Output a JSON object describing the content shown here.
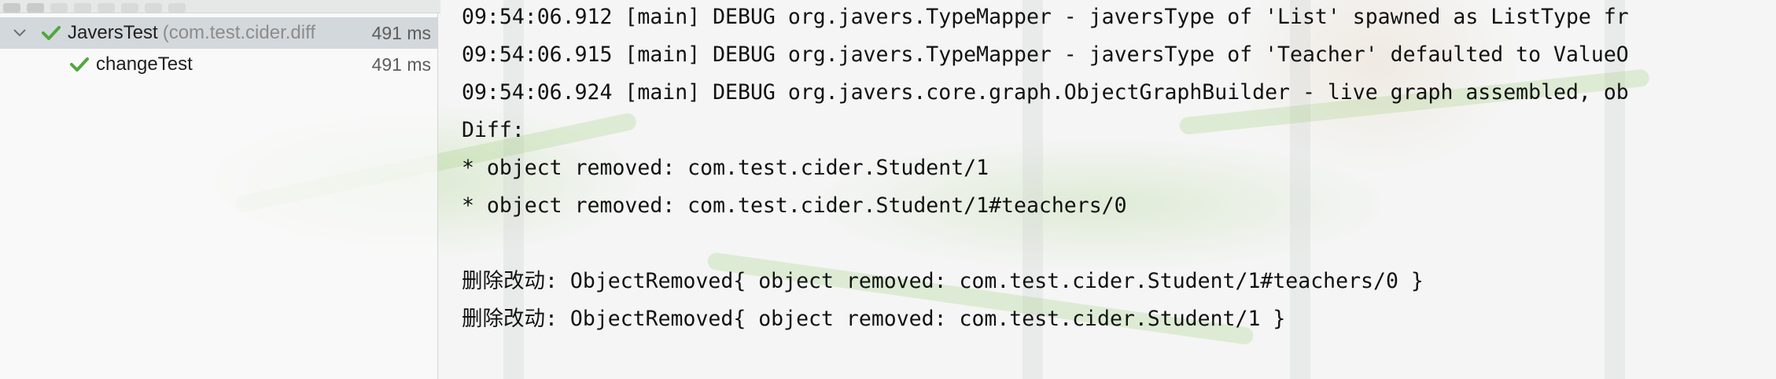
{
  "tree": {
    "suite": {
      "name": "JaversTest",
      "package": "(com.test.cider.diff",
      "duration": "491 ms",
      "status": "passed"
    },
    "tests": [
      {
        "name": "changeTest",
        "duration": "491 ms",
        "status": "passed"
      }
    ]
  },
  "console": {
    "lines": [
      "09:54:06.912 [main] DEBUG org.javers.TypeMapper - javersType of 'List' spawned as ListType fr",
      "09:54:06.915 [main] DEBUG org.javers.TypeMapper - javersType of 'Teacher' defaulted to ValueO",
      "09:54:06.924 [main] DEBUG org.javers.core.graph.ObjectGraphBuilder - live graph assembled, ob",
      "Diff:",
      "* object removed: com.test.cider.Student/1",
      "* object removed: com.test.cider.Student/1#teachers/0",
      "",
      "删除改动: ObjectRemoved{ object removed: com.test.cider.Student/1#teachers/0 }",
      "删除改动: ObjectRemoved{ object removed: com.test.cider.Student/1 }"
    ]
  },
  "colors": {
    "pass": "#4fa83d",
    "selection": "#cdd2d7",
    "console_text": "#111111"
  },
  "icons": {
    "expand": "chevron-down-icon",
    "status": "check-icon"
  }
}
